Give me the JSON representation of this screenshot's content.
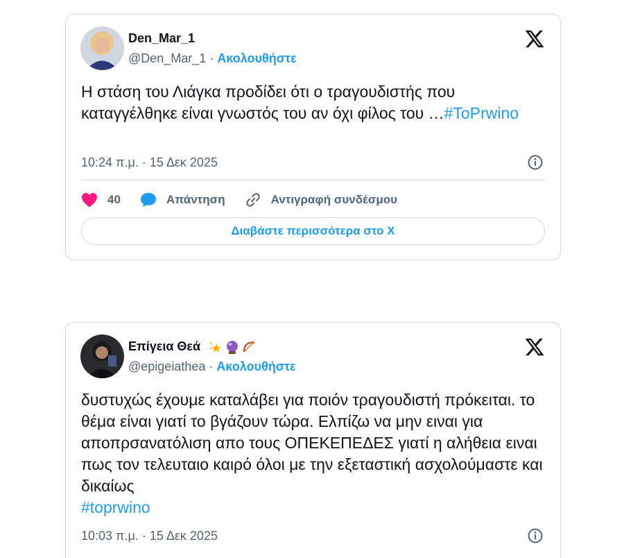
{
  "tweets": [
    {
      "name": "Den_Mar_1",
      "handle": "@Den_Mar_1",
      "separator": "·",
      "follow_label": "Ακολουθήστε",
      "text": "Η στάση του Λιάγκα προδίδει ότι ο τραγουδιστής που καταγγέλθηκε είναι γνωστός του αν όχι φίλος του …",
      "hashtag": "#ToPrwino",
      "timestamp": "10:24 π.μ. · 15 Δεκ 2025",
      "likes": "40",
      "reply_label": "Απάντηση",
      "copy_link_label": "Αντιγραφή συνδέσμου",
      "read_more_label": "Διαβάστε περισσότερα στο X"
    },
    {
      "name": "Επίγεια Θεά",
      "name_emojis": [
        "sparkles-star",
        "crystal-ball",
        "bow-and-arrow"
      ],
      "handle": "@epigeiathea",
      "separator": "·",
      "follow_label": "Ακολουθήστε",
      "text": "δυστυχώς έχουμε καταλάβει για ποιόν τραγουδιστή πρόκειται. το θέμα είναι γιατί το βγάζουν τώρα. Ελπίζω να μην ειναι για αποπρσανατόλιση απο τους ΟΠΕΚΕΠΕΔΕΣ γιατί η αλήθεια ειναι πως τον τελευταιο καιρό όλοι με την εξεταστική ασχολούμαστε και δικαίως",
      "hashtag": "#toprwino",
      "timestamp": "10:03 π.μ. · 15 Δεκ 2025"
    }
  ],
  "colors": {
    "accent": "#1d9bf0",
    "muted": "#536471",
    "border": "#cfd9de",
    "heart": "#f91880"
  }
}
